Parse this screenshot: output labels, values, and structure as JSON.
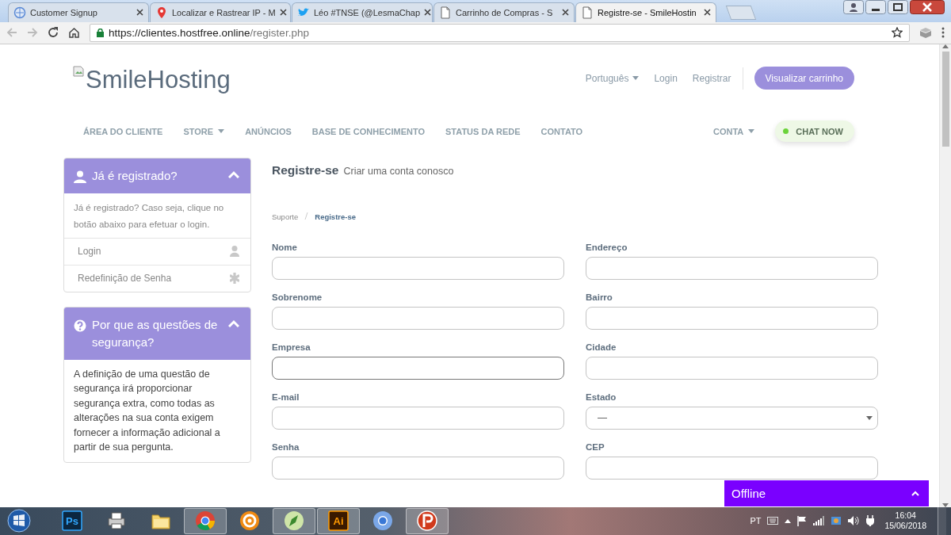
{
  "browser": {
    "tabs": [
      {
        "title": "Customer Signup",
        "selected": false
      },
      {
        "title": "Localizar e Rastrear IP - M",
        "selected": false
      },
      {
        "title": "Léo #TNSE (@LesmaChap",
        "selected": false
      },
      {
        "title": "Carrinho de Compras - S",
        "selected": false
      },
      {
        "title": "Registre-se - SmileHostin",
        "selected": true
      }
    ],
    "address": {
      "host": "https://clientes.hostfree.online",
      "path": "/register.php"
    }
  },
  "header": {
    "logo": "SmileHosting",
    "links": [
      {
        "label": "Português",
        "dropdown": true
      },
      {
        "label": "Login",
        "dropdown": false
      },
      {
        "label": "Registrar",
        "dropdown": false
      }
    ],
    "cart_button": "Visualizar carrinho"
  },
  "nav": {
    "items": [
      {
        "label": "ÁREA DO CLIENTE",
        "dropdown": false
      },
      {
        "label": "STORE",
        "dropdown": true
      },
      {
        "label": "ANÚNCIOS",
        "dropdown": false
      },
      {
        "label": "BASE DE CONHECIMENTO",
        "dropdown": false
      },
      {
        "label": "STATUS DA REDE",
        "dropdown": false
      },
      {
        "label": "CONTATO",
        "dropdown": false
      }
    ],
    "account": {
      "label": "CONTA",
      "dropdown": true
    },
    "chat_button": "CHAT NOW"
  },
  "sidebar": {
    "panels": [
      {
        "title": "Já é registrado?",
        "expanded": true,
        "text": "Já é registrado? Caso seja, clique no botão abaixo para efetuar o login.",
        "links": [
          {
            "label": "Login"
          },
          {
            "label": "Redefinição de Senha"
          }
        ]
      },
      {
        "title": "Por que as questões de segurança?",
        "expanded": true,
        "text": "A definição de uma questão de segurança irá proporcionar segurança extra, como todas as alterações na sua conta exigem fornecer a informação adicional a partir de sua pergunta."
      }
    ]
  },
  "page": {
    "title": "Registre-se",
    "subtitle": "Criar uma conta conosco",
    "breadcrumb": [
      {
        "label": "Suporte",
        "current": false
      },
      {
        "label": "Registre-se",
        "current": true
      }
    ]
  },
  "form": {
    "columns": [
      [
        {
          "label": "Nome",
          "kind": "text",
          "focused": false
        },
        {
          "label": "Sobrenome",
          "kind": "text",
          "focused": false
        },
        {
          "label": "Empresa",
          "kind": "text",
          "focused": true
        },
        {
          "label": "E-mail",
          "kind": "text",
          "focused": false
        },
        {
          "label": "Senha",
          "kind": "text",
          "focused": false
        }
      ],
      [
        {
          "label": "Endereço",
          "kind": "text",
          "focused": false
        },
        {
          "label": "Bairro",
          "kind": "text",
          "focused": false
        },
        {
          "label": "Cidade",
          "kind": "text",
          "focused": false
        },
        {
          "label": "Estado",
          "kind": "select",
          "value": "—",
          "focused": false
        },
        {
          "label": "CEP",
          "kind": "text",
          "focused": false
        }
      ]
    ]
  },
  "chat_widget": {
    "status": "Offline"
  },
  "taskbar": {
    "apps": [
      {
        "label": "Ps",
        "active": false
      },
      {
        "active": false
      },
      {
        "active": false
      },
      {
        "active": true
      },
      {
        "active": false
      },
      {
        "active": true
      },
      {
        "label": "Ai",
        "active": true
      },
      {
        "active": false
      },
      {
        "active": true
      }
    ],
    "tray": {
      "language": "PT",
      "time": "16:04",
      "date": "15/06/2018"
    }
  }
}
